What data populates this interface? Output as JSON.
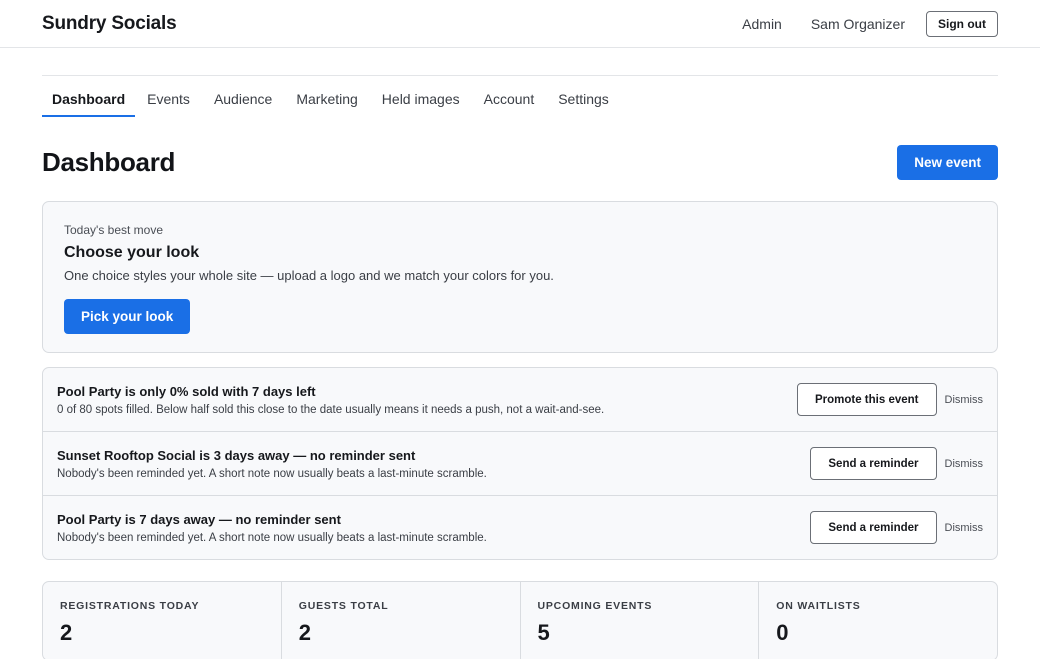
{
  "header": {
    "brand": "Sundry Socials",
    "admin_label": "Admin",
    "user_name": "Sam Organizer",
    "signout_label": "Sign out"
  },
  "tabs": [
    {
      "label": "Dashboard",
      "active": true
    },
    {
      "label": "Events"
    },
    {
      "label": "Audience"
    },
    {
      "label": "Marketing"
    },
    {
      "label": "Held images"
    },
    {
      "label": "Account"
    },
    {
      "label": "Settings"
    }
  ],
  "page": {
    "title": "Dashboard",
    "new_event_label": "New event"
  },
  "best_move": {
    "kicker": "Today's best move",
    "title": "Choose your look",
    "description": "One choice styles your whole site — upload a logo and we match your colors for you.",
    "button_label": "Pick your look"
  },
  "alerts": [
    {
      "title": "Pool Party is only 0% sold with 7 days left",
      "description": "0 of 80 spots filled. Below half sold this close to the date usually means it needs a push, not a wait-and-see.",
      "action_label": "Promote this event",
      "dismiss_label": "Dismiss"
    },
    {
      "title": "Sunset Rooftop Social is 3 days away — no reminder sent",
      "description": "Nobody's been reminded yet. A short note now usually beats a last-minute scramble.",
      "action_label": "Send a reminder",
      "dismiss_label": "Dismiss"
    },
    {
      "title": "Pool Party is 7 days away — no reminder sent",
      "description": "Nobody's been reminded yet. A short note now usually beats a last-minute scramble.",
      "action_label": "Send a reminder",
      "dismiss_label": "Dismiss"
    }
  ],
  "stats": [
    {
      "label": "REGISTRATIONS TODAY",
      "value": "2"
    },
    {
      "label": "GUESTS TOTAL",
      "value": "2"
    },
    {
      "label": "UPCOMING EVENTS",
      "value": "5"
    },
    {
      "label": "ON WAITLISTS",
      "value": "0"
    }
  ],
  "colors": {
    "accent": "#1a6fe6",
    "card_bg": "#f8f9fb",
    "border": "#d9dce0"
  }
}
